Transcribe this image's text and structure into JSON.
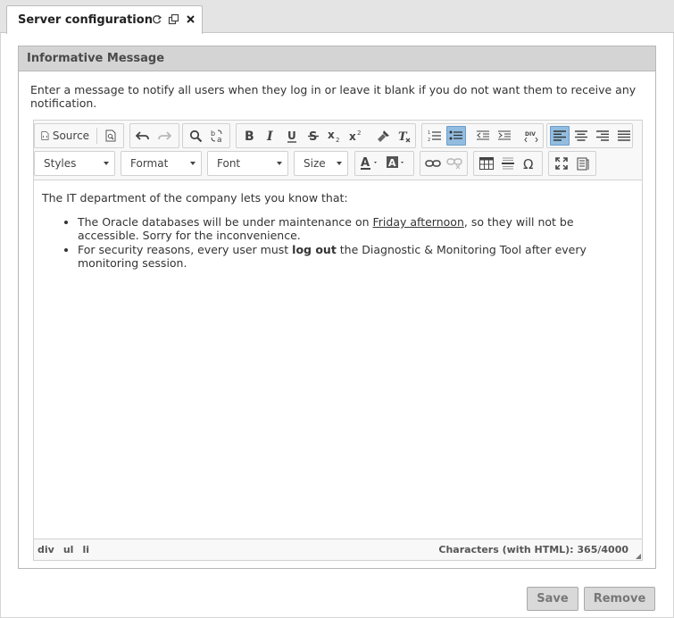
{
  "tab": {
    "title": "Server configuration",
    "icons": [
      "refresh-icon",
      "popout-icon",
      "close-icon"
    ]
  },
  "panel": {
    "title": "Informative Message",
    "description": "Enter a message to notify all users when they log in or leave it blank if you do not want them to receive any notification."
  },
  "editor": {
    "toolbar": {
      "source_label": "Source",
      "styles_label": "Styles",
      "format_label": "Format",
      "font_label": "Font",
      "size_label": "Size"
    },
    "content": {
      "intro": "The IT department of the company lets you know that:",
      "item1_before": "The Oracle databases will be under maintenance on ",
      "item1_link": "Friday afternoon",
      "item1_after": ", so they will not be accessible. Sorry for the inconvenience.",
      "item2_before": "For security reasons, every user must ",
      "item2_bold": "log out",
      "item2_after": " the Diagnostic & Monitoring Tool after every monitoring session."
    },
    "status": {
      "path": [
        "div",
        "ul",
        "li"
      ],
      "count": "Characters (with HTML): 365/4000"
    }
  },
  "buttons": {
    "save": "Save",
    "remove": "Remove"
  },
  "colors": {
    "active_button": "#92bce0",
    "header_bg": "#d4d4d4"
  }
}
